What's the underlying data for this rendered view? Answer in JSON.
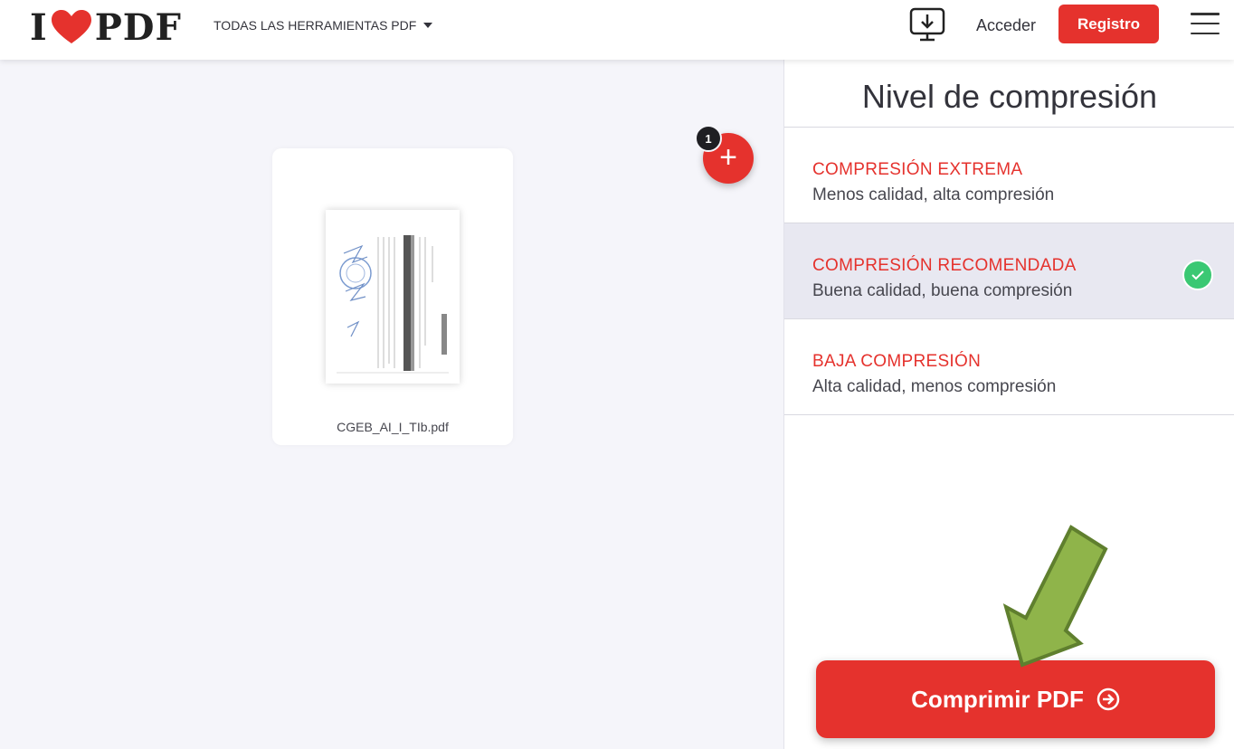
{
  "header": {
    "logo_left": "I",
    "logo_right": "PDF",
    "tools_menu_label": "TODAS LAS HERRAMIENTAS PDF",
    "login_label": "Acceder",
    "register_label": "Registro"
  },
  "workspace": {
    "file_name": "CGEB_AI_I_TIb.pdf",
    "file_count": "1",
    "add_label": "+"
  },
  "sidebar": {
    "title": "Nivel de compresión",
    "options": [
      {
        "title": "COMPRESIÓN EXTREMA",
        "description": "Menos calidad, alta compresión",
        "selected": false
      },
      {
        "title": "COMPRESIÓN RECOMENDADA",
        "description": "Buena calidad, buena compresión",
        "selected": true
      },
      {
        "title": "BAJA COMPRESIÓN",
        "description": "Alta calidad, menos compresión",
        "selected": false
      }
    ],
    "compress_label": "Comprimir PDF"
  },
  "colors": {
    "brand_red": "#e5322d",
    "selected_bg": "#e8e8f1",
    "check_green": "#3ac873",
    "annotation_arrow": "#8fb44a"
  },
  "icons": {
    "logo": "heart-icon",
    "desktop": "desktop-download-icon",
    "menu": "hamburger-menu-icon",
    "add": "plus-icon",
    "check": "check-icon",
    "compress": "arrow-right-circle-icon"
  }
}
